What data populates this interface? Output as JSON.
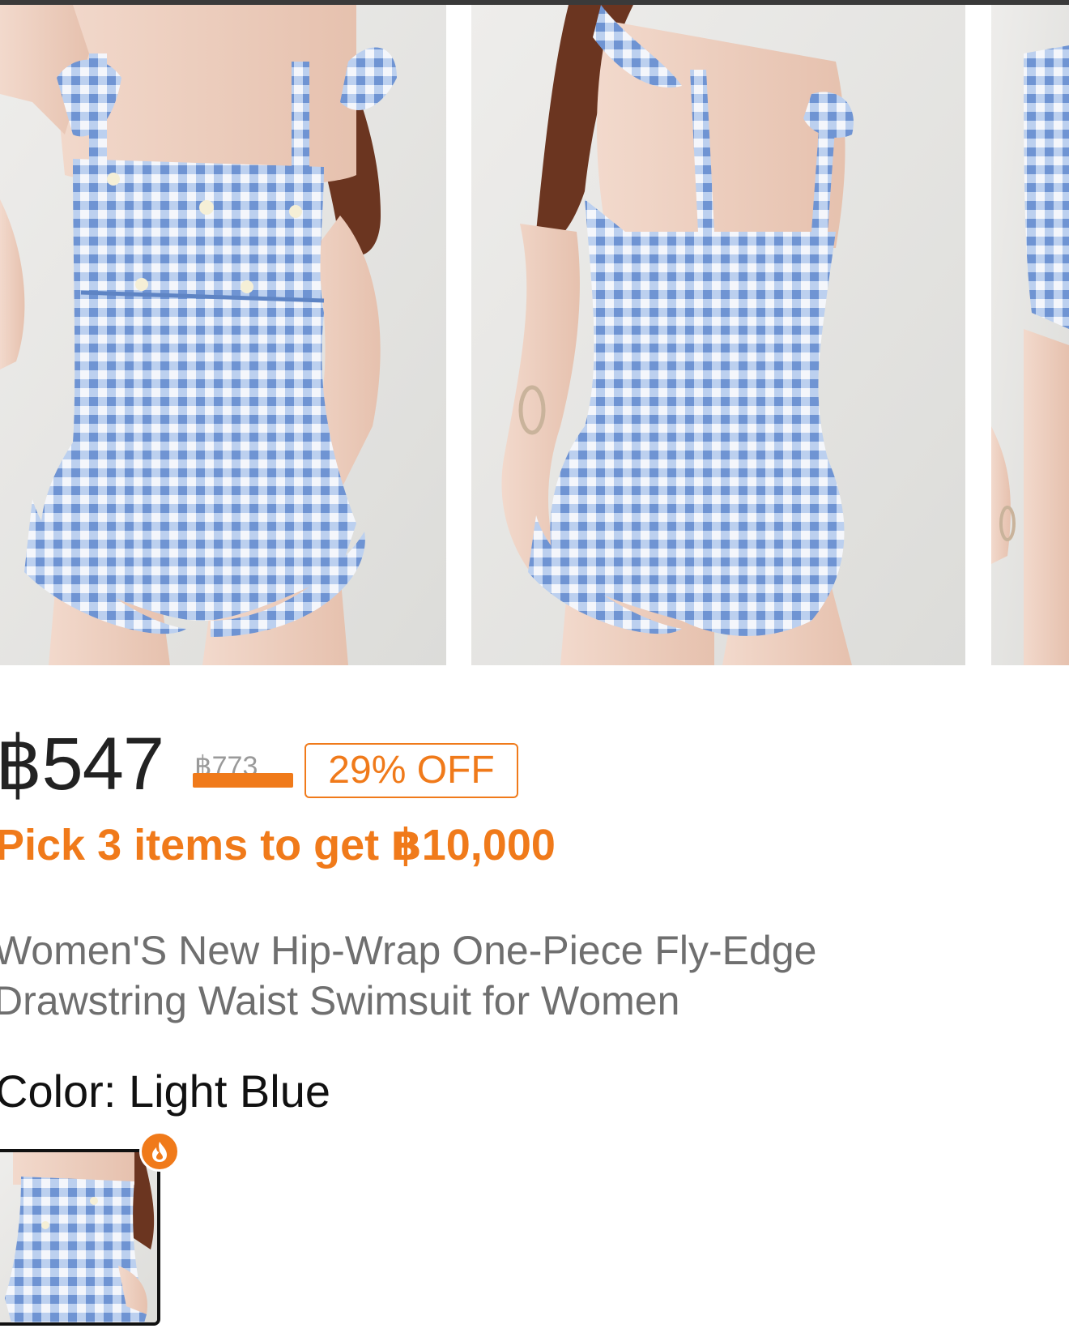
{
  "product": {
    "price": "฿547",
    "original_price": "฿773",
    "discount": "29% OFF",
    "promo": "Pick 3 items to get ฿10,000",
    "title": "Women'S New Hip-Wrap One-Piece Fly-Edge Drawstring Waist Swimsuit for Women",
    "color_label": "Color: Light Blue"
  },
  "gallery": {
    "images": [
      {
        "icon": "swimsuit-front-photo"
      },
      {
        "icon": "swimsuit-back-photo"
      },
      {
        "icon": "swimsuit-side-photo"
      }
    ]
  },
  "swatches": [
    {
      "icon": "light-blue-swatch",
      "selected": true,
      "badge_icon": "fire-icon"
    }
  ],
  "colors": {
    "accent": "#f07a1a",
    "price_text": "#222222",
    "title_text": "#6f6f6f",
    "gingham": "#8fb0e0"
  }
}
